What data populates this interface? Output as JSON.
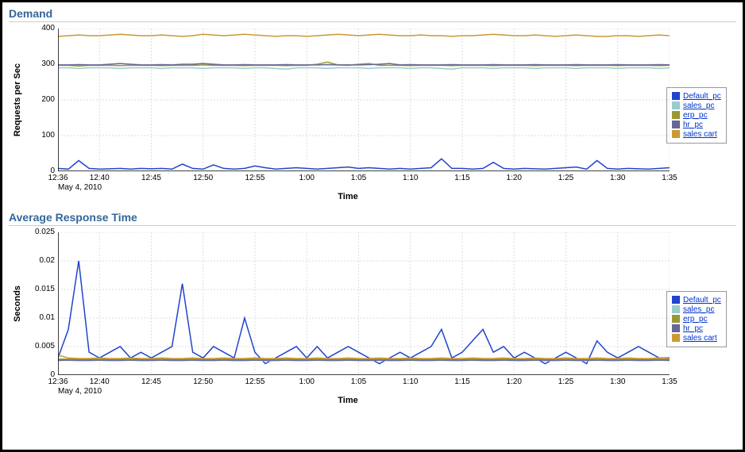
{
  "date_label": "May 4, 2010",
  "x_times": [
    "12:36",
    "12:40",
    "12:45",
    "12:50",
    "12:55",
    "1:00",
    "1:05",
    "1:10",
    "1:15",
    "1:20",
    "1:25",
    "1:30",
    "1:35"
  ],
  "xlabel": "Time",
  "legend": {
    "items": [
      {
        "name": "Default_pc",
        "color": "#2044cc"
      },
      {
        "name": "sales_pc",
        "color": "#99cccc"
      },
      {
        "name": "erp_pc",
        "color": "#999933"
      },
      {
        "name": "hr_pc",
        "color": "#666699"
      },
      {
        "name": "sales cart",
        "color": "#cc9933"
      }
    ]
  },
  "chart_data": [
    {
      "title": "Demand",
      "type": "line",
      "ylabel": "Requests per Sec",
      "ylim": [
        0,
        400
      ],
      "yticks": [
        0,
        100,
        200,
        300,
        400
      ],
      "x": [
        "12:36",
        "12:37",
        "12:38",
        "12:39",
        "12:40",
        "12:41",
        "12:42",
        "12:43",
        "12:44",
        "12:45",
        "12:46",
        "12:47",
        "12:48",
        "12:49",
        "12:50",
        "12:51",
        "12:52",
        "12:53",
        "12:54",
        "12:55",
        "12:56",
        "12:57",
        "12:58",
        "12:59",
        "1:00",
        "1:01",
        "1:02",
        "1:03",
        "1:04",
        "1:05",
        "1:06",
        "1:07",
        "1:08",
        "1:09",
        "1:10",
        "1:11",
        "1:12",
        "1:13",
        "1:14",
        "1:15",
        "1:16",
        "1:17",
        "1:18",
        "1:19",
        "1:20",
        "1:21",
        "1:22",
        "1:23",
        "1:24",
        "1:25",
        "1:26",
        "1:27",
        "1:28",
        "1:29",
        "1:30",
        "1:31",
        "1:32",
        "1:33",
        "1:34",
        "1:35"
      ],
      "series": [
        {
          "name": "Default_pc",
          "color": "#2044cc",
          "values": [
            8,
            6,
            30,
            8,
            6,
            7,
            8,
            6,
            8,
            7,
            8,
            6,
            20,
            8,
            6,
            18,
            8,
            6,
            8,
            15,
            10,
            6,
            8,
            10,
            8,
            6,
            8,
            10,
            12,
            8,
            10,
            8,
            6,
            8,
            6,
            8,
            10,
            35,
            8,
            8,
            6,
            8,
            25,
            8,
            6,
            8,
            7,
            6,
            8,
            10,
            12,
            6,
            30,
            8,
            6,
            8,
            7,
            6,
            8,
            10
          ]
        },
        {
          "name": "sales_pc",
          "color": "#99cccc",
          "values": [
            290,
            290,
            288,
            290,
            290,
            290,
            288,
            290,
            290,
            290,
            288,
            290,
            290,
            290,
            288,
            290,
            290,
            290,
            288,
            290,
            290,
            288,
            286,
            290,
            290,
            290,
            288,
            290,
            290,
            290,
            288,
            290,
            290,
            290,
            288,
            290,
            290,
            288,
            286,
            290,
            290,
            290,
            288,
            290,
            290,
            290,
            288,
            290,
            290,
            290,
            288,
            290,
            290,
            290,
            288,
            290,
            290,
            290,
            288,
            290
          ]
        },
        {
          "name": "erp_pc",
          "color": "#999933",
          "values": [
            297,
            297,
            295,
            297,
            297,
            297,
            296,
            297,
            297,
            297,
            296,
            297,
            297,
            297,
            298,
            297,
            297,
            297,
            296,
            297,
            297,
            297,
            296,
            297,
            297,
            300,
            306,
            298,
            297,
            300,
            302,
            297,
            297,
            297,
            296,
            297,
            297,
            297,
            296,
            297,
            297,
            297,
            296,
            297,
            297,
            297,
            296,
            297,
            297,
            297,
            296,
            297,
            297,
            297,
            296,
            297,
            297,
            297,
            296,
            297
          ]
        },
        {
          "name": "hr_pc",
          "color": "#666699",
          "values": [
            298,
            298,
            299,
            298,
            298,
            300,
            302,
            300,
            298,
            298,
            299,
            298,
            300,
            300,
            302,
            300,
            298,
            298,
            299,
            298,
            298,
            298,
            299,
            298,
            298,
            298,
            299,
            298,
            298,
            298,
            299,
            300,
            302,
            298,
            299,
            298,
            298,
            298,
            299,
            298,
            298,
            298,
            299,
            298,
            298,
            298,
            299,
            298,
            298,
            298,
            299,
            298,
            298,
            298,
            299,
            298,
            298,
            298,
            299,
            298
          ]
        },
        {
          "name": "sales cart",
          "color": "#cc9933",
          "values": [
            378,
            380,
            382,
            380,
            380,
            382,
            384,
            382,
            380,
            380,
            382,
            380,
            378,
            380,
            384,
            382,
            380,
            382,
            384,
            382,
            380,
            378,
            380,
            380,
            378,
            380,
            382,
            384,
            382,
            380,
            382,
            384,
            382,
            380,
            380,
            382,
            380,
            380,
            378,
            380,
            380,
            382,
            384,
            382,
            380,
            380,
            382,
            380,
            378,
            380,
            382,
            380,
            378,
            378,
            380,
            380,
            378,
            380,
            382,
            380
          ]
        }
      ]
    },
    {
      "title": "Average Response Time",
      "type": "line",
      "ylabel": "Seconds",
      "ylim": [
        0,
        0.025
      ],
      "yticks": [
        0.0,
        0.005,
        0.01,
        0.015,
        0.02,
        0.025
      ],
      "x": [
        "12:36",
        "12:37",
        "12:38",
        "12:39",
        "12:40",
        "12:41",
        "12:42",
        "12:43",
        "12:44",
        "12:45",
        "12:46",
        "12:47",
        "12:48",
        "12:49",
        "12:50",
        "12:51",
        "12:52",
        "12:53",
        "12:54",
        "12:55",
        "12:56",
        "12:57",
        "12:58",
        "12:59",
        "1:00",
        "1:01",
        "1:02",
        "1:03",
        "1:04",
        "1:05",
        "1:06",
        "1:07",
        "1:08",
        "1:09",
        "1:10",
        "1:11",
        "1:12",
        "1:13",
        "1:14",
        "1:15",
        "1:16",
        "1:17",
        "1:18",
        "1:19",
        "1:20",
        "1:21",
        "1:22",
        "1:23",
        "1:24",
        "1:25",
        "1:26",
        "1:27",
        "1:28",
        "1:29",
        "1:30",
        "1:31",
        "1:32",
        "1:33",
        "1:34",
        "1:35"
      ],
      "series": [
        {
          "name": "Default_pc",
          "color": "#2044cc",
          "values": [
            0.003,
            0.008,
            0.02,
            0.004,
            0.003,
            0.004,
            0.005,
            0.003,
            0.004,
            0.003,
            0.004,
            0.005,
            0.016,
            0.004,
            0.003,
            0.005,
            0.004,
            0.003,
            0.01,
            0.004,
            0.002,
            0.003,
            0.004,
            0.005,
            0.003,
            0.005,
            0.003,
            0.004,
            0.005,
            0.004,
            0.003,
            0.002,
            0.003,
            0.004,
            0.003,
            0.004,
            0.005,
            0.008,
            0.003,
            0.004,
            0.006,
            0.008,
            0.004,
            0.005,
            0.003,
            0.004,
            0.003,
            0.002,
            0.003,
            0.004,
            0.003,
            0.002,
            0.006,
            0.004,
            0.003,
            0.004,
            0.005,
            0.004,
            0.003,
            0.003
          ]
        },
        {
          "name": "sales_pc",
          "color": "#99cccc",
          "values": [
            0.0025,
            0.0026,
            0.0025,
            0.0025,
            0.0026,
            0.0025,
            0.0025,
            0.0026,
            0.0025,
            0.0025,
            0.0026,
            0.0025,
            0.0025,
            0.0026,
            0.0025,
            0.0025,
            0.0026,
            0.0025,
            0.0025,
            0.0026,
            0.0025,
            0.0025,
            0.0026,
            0.0025,
            0.0025,
            0.0026,
            0.0025,
            0.0025,
            0.0026,
            0.0025,
            0.0025,
            0.0026,
            0.0025,
            0.0025,
            0.0026,
            0.0025,
            0.0025,
            0.0026,
            0.0025,
            0.0025,
            0.0026,
            0.0025,
            0.0025,
            0.0026,
            0.0025,
            0.0025,
            0.0026,
            0.0025,
            0.0025,
            0.0026,
            0.0025,
            0.0025,
            0.0026,
            0.0025,
            0.0025,
            0.0026,
            0.0025,
            0.0025,
            0.0026,
            0.0025
          ]
        },
        {
          "name": "erp_pc",
          "color": "#999933",
          "values": [
            0.0028,
            0.0028,
            0.0028,
            0.0028,
            0.0028,
            0.0028,
            0.0028,
            0.0028,
            0.0028,
            0.0028,
            0.0028,
            0.0028,
            0.0028,
            0.0028,
            0.0028,
            0.0028,
            0.0028,
            0.0028,
            0.0028,
            0.0028,
            0.0028,
            0.0028,
            0.0028,
            0.0028,
            0.0028,
            0.0028,
            0.0028,
            0.0028,
            0.0028,
            0.0028,
            0.0028,
            0.0028,
            0.0028,
            0.0028,
            0.0028,
            0.0028,
            0.0028,
            0.0028,
            0.0028,
            0.0028,
            0.0028,
            0.0028,
            0.0028,
            0.0028,
            0.0028,
            0.0028,
            0.0028,
            0.0028,
            0.0028,
            0.0028,
            0.0028,
            0.0028,
            0.0028,
            0.0028,
            0.0028,
            0.0028,
            0.0028,
            0.0028,
            0.0028,
            0.0028
          ]
        },
        {
          "name": "hr_pc",
          "color": "#666699",
          "values": [
            0.0026,
            0.0026,
            0.0026,
            0.0026,
            0.0026,
            0.0026,
            0.0026,
            0.0026,
            0.0026,
            0.0026,
            0.0026,
            0.0026,
            0.0026,
            0.0026,
            0.0026,
            0.0026,
            0.0026,
            0.0026,
            0.0026,
            0.0026,
            0.0026,
            0.0026,
            0.0026,
            0.0026,
            0.0026,
            0.0026,
            0.0026,
            0.0026,
            0.0026,
            0.0026,
            0.0026,
            0.0026,
            0.0026,
            0.0026,
            0.0026,
            0.0026,
            0.0026,
            0.0026,
            0.0026,
            0.0026,
            0.0026,
            0.0026,
            0.0026,
            0.0026,
            0.0026,
            0.0026,
            0.0026,
            0.0026,
            0.0026,
            0.0026,
            0.0026,
            0.0026,
            0.0026,
            0.0026,
            0.0026,
            0.0026,
            0.0026,
            0.0026,
            0.0026,
            0.0026
          ]
        },
        {
          "name": "sales cart",
          "color": "#cc9933",
          "values": [
            0.0035,
            0.003,
            0.0029,
            0.0029,
            0.003,
            0.0029,
            0.0029,
            0.003,
            0.0029,
            0.0029,
            0.003,
            0.0029,
            0.0029,
            0.003,
            0.0029,
            0.0029,
            0.003,
            0.0029,
            0.0029,
            0.003,
            0.0029,
            0.0029,
            0.003,
            0.0029,
            0.0029,
            0.003,
            0.0029,
            0.0029,
            0.003,
            0.0029,
            0.0029,
            0.003,
            0.0029,
            0.0029,
            0.003,
            0.0029,
            0.0029,
            0.003,
            0.0029,
            0.0029,
            0.003,
            0.0029,
            0.0029,
            0.003,
            0.0029,
            0.0029,
            0.003,
            0.0029,
            0.0029,
            0.003,
            0.0029,
            0.0029,
            0.003,
            0.0029,
            0.0029,
            0.003,
            0.0029,
            0.0029,
            0.003,
            0.0029
          ]
        }
      ]
    }
  ]
}
